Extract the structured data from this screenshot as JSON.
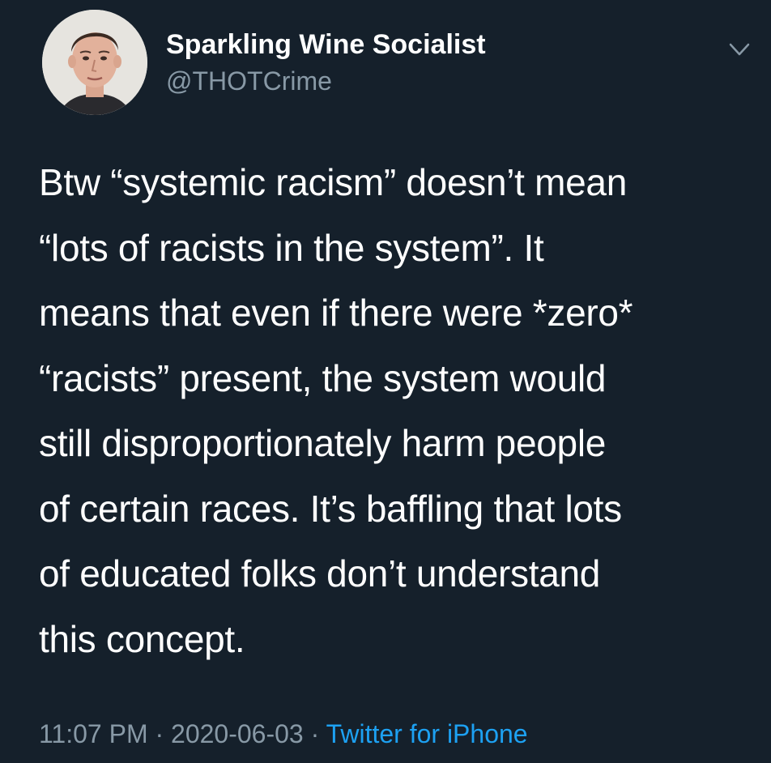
{
  "author": {
    "display_name": "Sparkling Wine Socialist",
    "handle": "@THOTCrime"
  },
  "tweet": {
    "lines": [
      "Btw “systemic racism” doesn’t mean",
      "“lots of racists in the system”. It",
      "means that even if there were *zero*",
      "“racists” present, the system would",
      "still disproportionately harm people",
      "of certain races. It’s baffling that lots",
      "of educated folks don’t understand",
      "this concept."
    ]
  },
  "meta": {
    "time": "11:07 PM",
    "separator": "·",
    "date": "2020-06-03",
    "source": "Twitter for iPhone"
  },
  "colors": {
    "background": "#15202b",
    "primary_text": "#ffffff",
    "secondary_text": "#8899a6",
    "link": "#1da1f2"
  },
  "icons": {
    "menu": "chevron-down-icon"
  }
}
